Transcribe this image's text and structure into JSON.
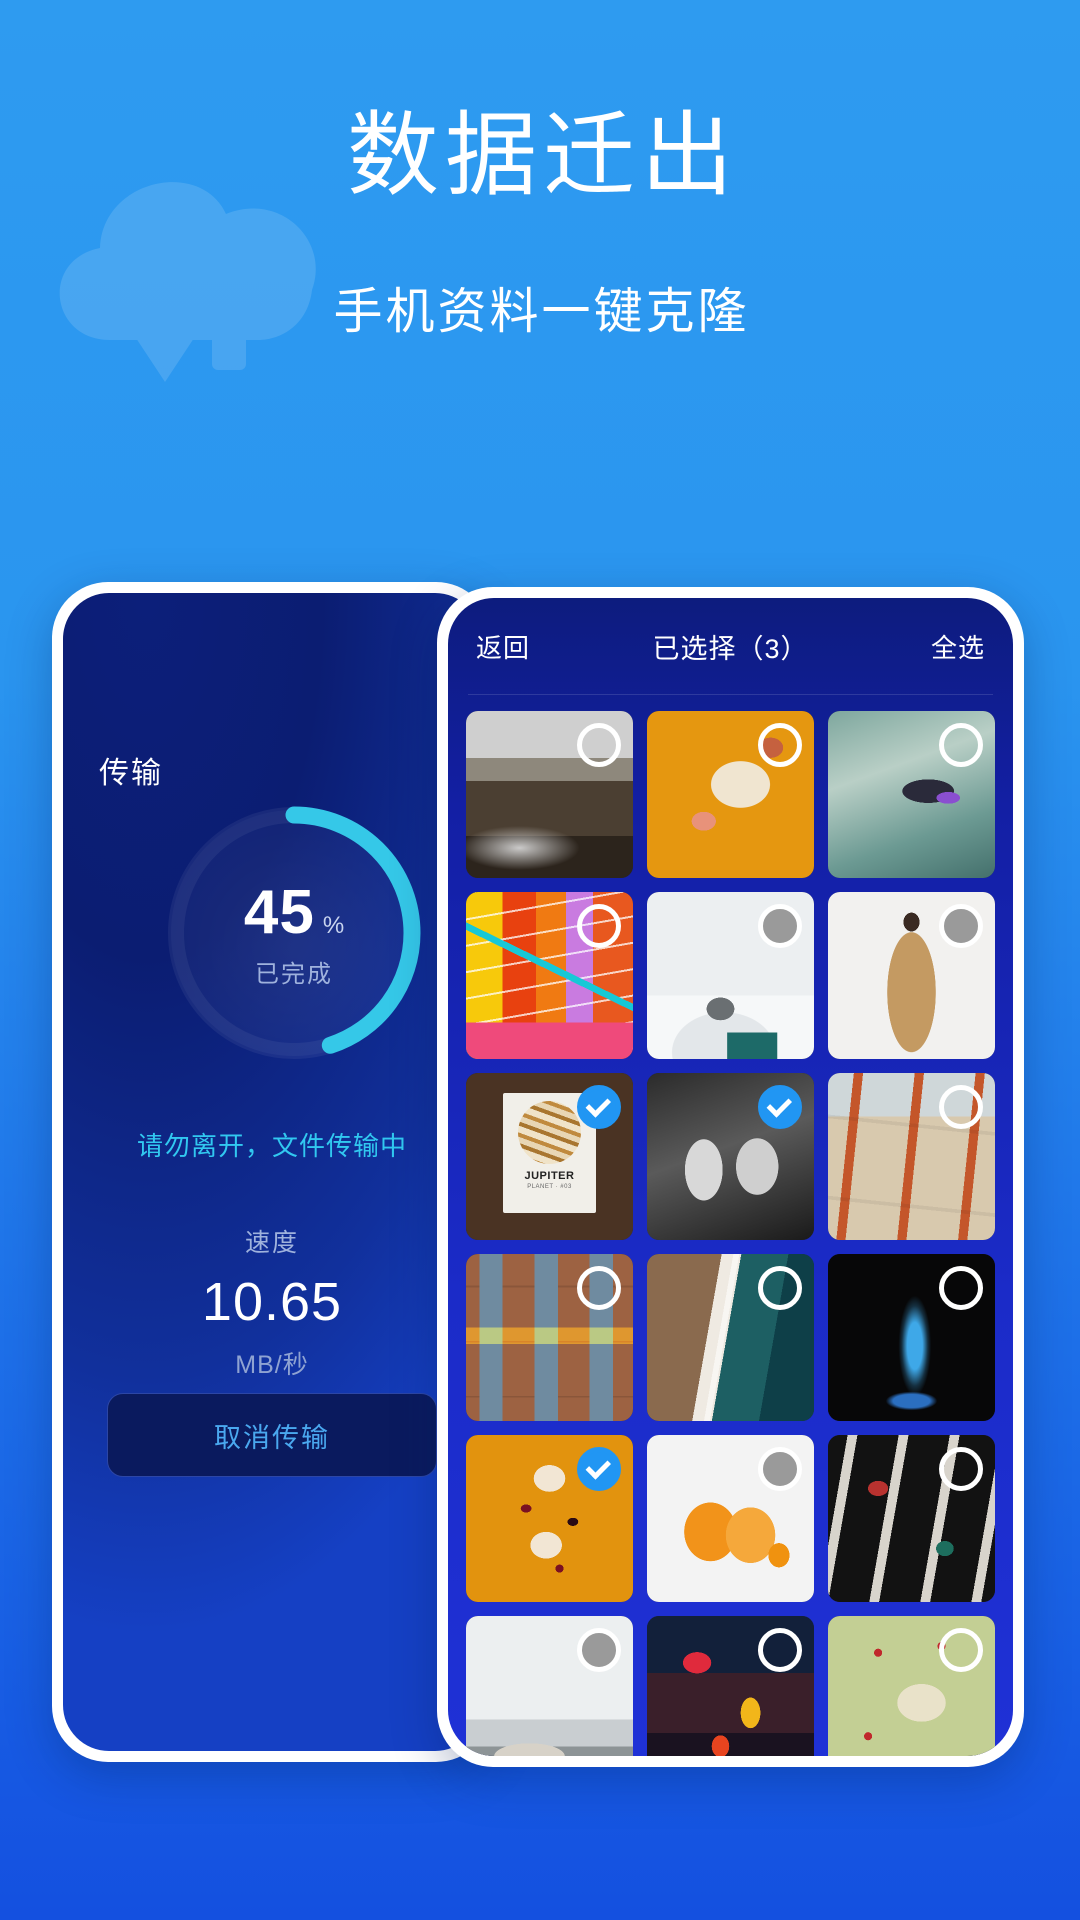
{
  "hero": {
    "title": "数据迁出",
    "subtitle": "手机资料一键克隆",
    "background_color": "#2196f3",
    "cloud_icon": "cloud-sync-icon"
  },
  "left_phone": {
    "title": "传输",
    "progress": {
      "percent": "45",
      "percent_symbol": "%",
      "label": "已完成",
      "value": 45,
      "track_color": "#2b3fa0",
      "arc_color": "#35c8e8"
    },
    "tip": "请勿离开，文件传输中",
    "speed": {
      "label": "速度",
      "value": "10.65",
      "unit": "MB/秒"
    },
    "cancel_button": "取消传输"
  },
  "right_phone": {
    "header": {
      "back": "返回",
      "title": "已选择（3）",
      "select_all": "全选"
    },
    "selected_count": 3,
    "photos": [
      {
        "name": "winding-road-landscape",
        "selected": false,
        "check_style": "outline"
      },
      {
        "name": "paleo-jar-orange",
        "selected": false,
        "check_style": "outline"
      },
      {
        "name": "surfer-wave",
        "selected": false,
        "check_style": "outline"
      },
      {
        "name": "colorful-geometric-graphic",
        "selected": false,
        "check_style": "outline"
      },
      {
        "name": "snow-observatory",
        "selected": false,
        "check_style": "grey"
      },
      {
        "name": "woman-tan-coat",
        "selected": false,
        "check_style": "grey"
      },
      {
        "name": "jupiter-planet-card",
        "selected": true,
        "check_style": "checked"
      },
      {
        "name": "bw-street-crowd",
        "selected": true,
        "check_style": "checked"
      },
      {
        "name": "benches-plaza-aerial",
        "selected": false,
        "check_style": "outline"
      },
      {
        "name": "brick-apartment-windows",
        "selected": false,
        "check_style": "outline"
      },
      {
        "name": "coastline-aerial",
        "selected": false,
        "check_style": "outline"
      },
      {
        "name": "blue-liquid-dark",
        "selected": false,
        "check_style": "outline"
      },
      {
        "name": "dessert-splash-orange",
        "selected": true,
        "check_style": "checked"
      },
      {
        "name": "oranges-white",
        "selected": false,
        "check_style": "grey"
      },
      {
        "name": "dark-tabletop-items",
        "selected": false,
        "check_style": "outline"
      },
      {
        "name": "foggy-lake-rocks",
        "selected": false,
        "check_style": "grey"
      },
      {
        "name": "neon-night-street",
        "selected": false,
        "check_style": "outline"
      },
      {
        "name": "green-flatlay-snacks",
        "selected": false,
        "check_style": "outline"
      }
    ]
  }
}
